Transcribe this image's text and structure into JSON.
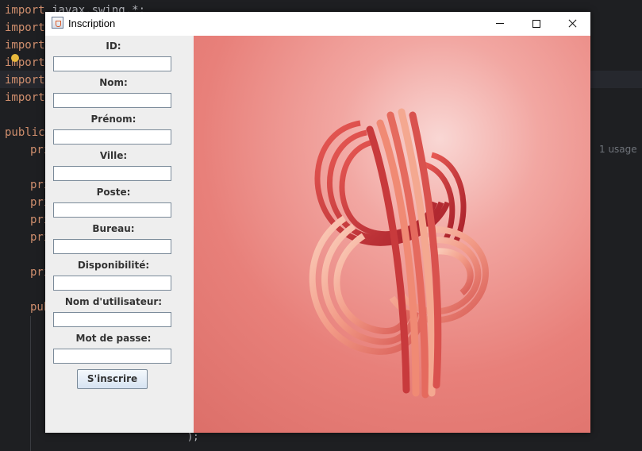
{
  "ide": {
    "lines": [
      {
        "kw": "import",
        "rest": " javax.swing.*;"
      },
      {
        "kw": "import",
        "rest": ""
      },
      {
        "kw": "import",
        "rest": ""
      },
      {
        "kw": "import",
        "rest": ""
      },
      {
        "kw": "import",
        "rest": ""
      },
      {
        "kw": "import",
        "rest": ""
      },
      {
        "kw": "public",
        "rest": ""
      },
      {
        "kw": "pri",
        "rest": ""
      },
      {
        "kw": "pri",
        "rest": ""
      },
      {
        "kw": "pri",
        "rest": ""
      },
      {
        "kw": "pri",
        "rest": ""
      },
      {
        "kw": "pri",
        "rest": ""
      },
      {
        "kw": "pri",
        "rest": ""
      },
      {
        "kw": "pub",
        "rest": ""
      }
    ],
    "usage_hint": "1 usage",
    "stray_text": ");"
  },
  "window": {
    "title": "Inscription",
    "controls": {
      "minimize": "minimize",
      "maximize": "maximize",
      "close": "close"
    }
  },
  "form": {
    "fields": [
      {
        "label": "ID:",
        "value": ""
      },
      {
        "label": "Nom:",
        "value": ""
      },
      {
        "label": "Prénom:",
        "value": ""
      },
      {
        "label": "Ville:",
        "value": ""
      },
      {
        "label": "Poste:",
        "value": ""
      },
      {
        "label": "Bureau:",
        "value": ""
      },
      {
        "label": "Disponibilité:",
        "value": ""
      },
      {
        "label": "Nom d'utilisateur:",
        "value": ""
      },
      {
        "label": "Mot de passe:",
        "value": ""
      }
    ],
    "submit_label": "S'inscrire"
  },
  "image": {
    "subject": "abstract-red-knot",
    "colors": {
      "background": "#e8807a",
      "knot_dark": "#b8242b",
      "knot_light": "#f6b79f"
    }
  },
  "theme": {
    "ide_bg": "#1e1f22",
    "keyword": "#cf8e6d",
    "panel_bg": "#eeeeee"
  }
}
